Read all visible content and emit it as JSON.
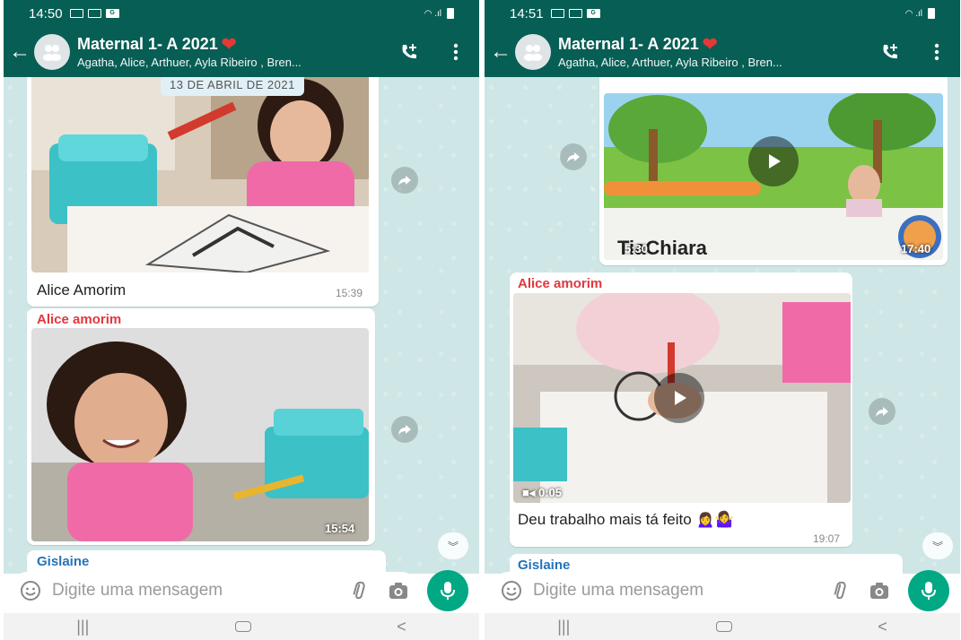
{
  "colors": {
    "header": "#075e54",
    "chat_bg": "#cfe6e6",
    "sender_red": "#e0383e",
    "sender_blue": "#2673b8",
    "mic": "#00a884"
  },
  "left": {
    "status": {
      "time": "14:50"
    },
    "header": {
      "title": "Maternal 1- A 2021",
      "heart": "❤",
      "subtitle": "Agatha, Alice, Arthuer, Ayla Ribeiro , Bren..."
    },
    "date_chip": "13 DE ABRIL DE 2021",
    "msg1": {
      "caption": "Alice Amorim",
      "time": "15:39"
    },
    "msg2": {
      "sender": "Alice amorim",
      "time": "15:54"
    },
    "msg3": {
      "sender": "Gislaine"
    },
    "input": {
      "placeholder": "Digite uma mensagem"
    },
    "nav": {
      "recents": "|||",
      "back": "<"
    }
  },
  "right": {
    "status": {
      "time": "14:51"
    },
    "header": {
      "title": "Maternal 1- A 2021",
      "heart": "❤",
      "subtitle": "Agatha, Alice, Arthuer, Ayla Ribeiro , Bren..."
    },
    "video1": {
      "overlay_text": "TiaChiara",
      "duration": "5:30",
      "time": "17:40"
    },
    "msg2": {
      "sender": "Alice amorim",
      "duration": "0:05",
      "caption": "Deu trabalho mais tá feito",
      "emoji": "🙍‍♀️🤷‍♀️",
      "time": "19:07"
    },
    "msg3": {
      "sender": "Gislaine"
    },
    "input": {
      "placeholder": "Digite uma mensagem"
    },
    "nav": {
      "recents": "|||",
      "back": "<"
    }
  }
}
